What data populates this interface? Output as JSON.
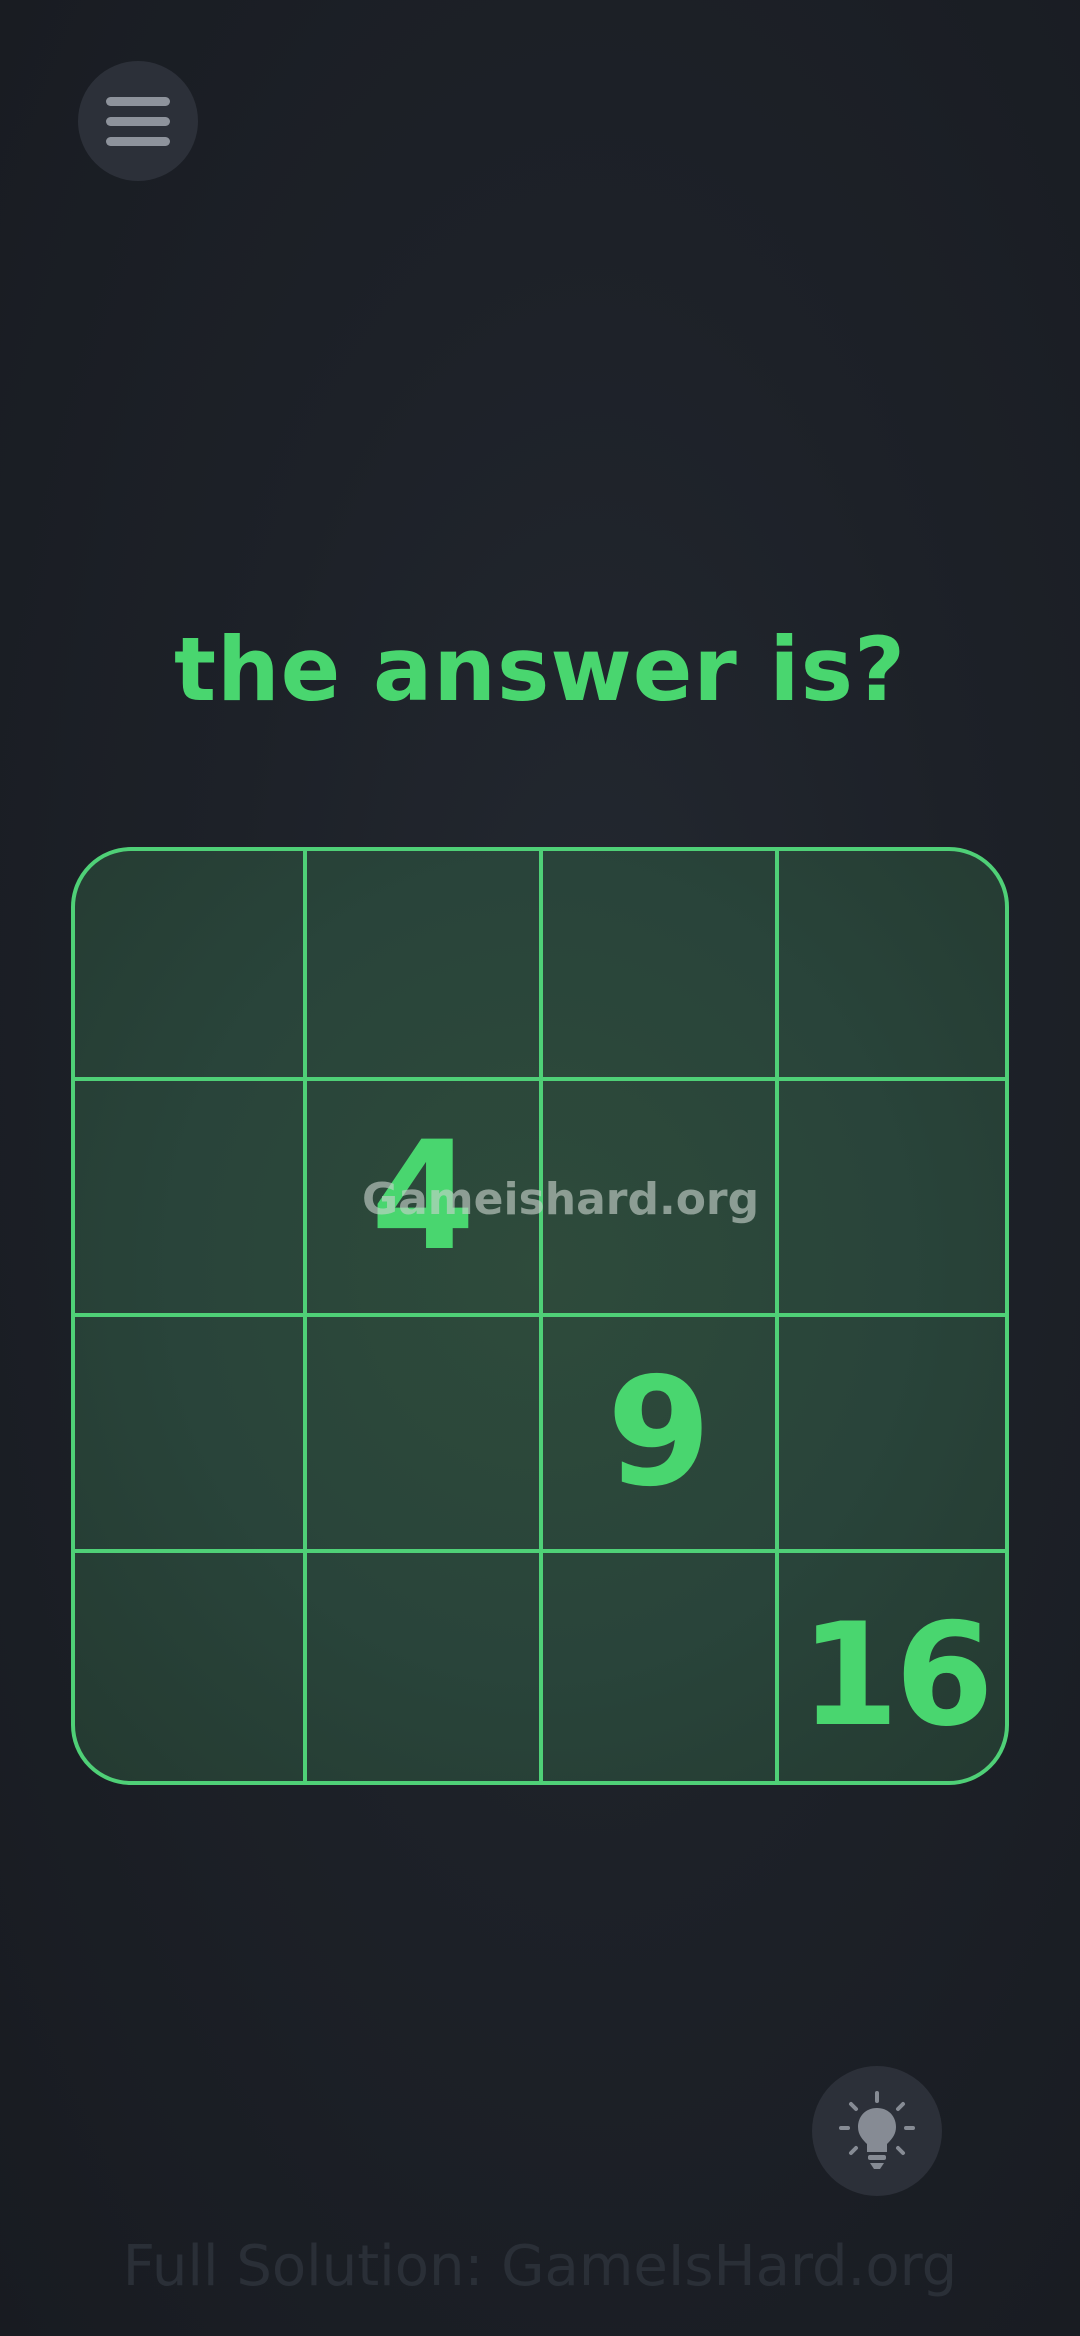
{
  "menu": {
    "icon": "hamburger-menu-icon"
  },
  "question": "the answer is?",
  "grid": {
    "rows": [
      [
        "",
        "",
        "",
        ""
      ],
      [
        "",
        "4",
        "",
        ""
      ],
      [
        "",
        "",
        "9",
        ""
      ],
      [
        "",
        "",
        "",
        "16"
      ]
    ]
  },
  "watermark": "Gameishard.org",
  "hint": {
    "icon": "lightbulb-icon"
  },
  "footer": "Full Solution: GameIsHard.org",
  "colors": {
    "accent": "#49d66f",
    "grid_line": "#4fd077",
    "background": "#1d2128",
    "cell_fill": "#2b473a"
  }
}
